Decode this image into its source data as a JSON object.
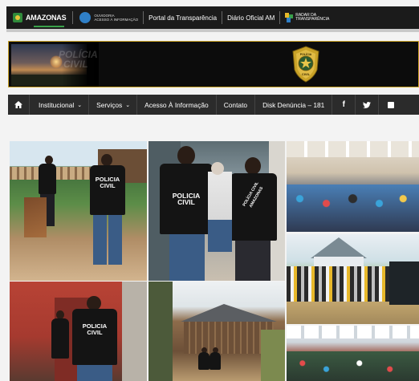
{
  "gov_bar": {
    "brand": "AMAZONAS",
    "ouvidoria_line1": "OUVIDORIA",
    "ouvidoria_line2": "ACESSO À INFORMAÇÃO",
    "link_transparencia": "Portal da Transparência",
    "link_diario": "Diário Oficial AM",
    "radar_line1": "RADAR DA",
    "radar_line2": "TRANSPARÊNCIA"
  },
  "banner": {
    "watermark_line1": "POLÍCIA",
    "watermark_line2": "CIVIL",
    "badge_top": "POLÍCIA",
    "badge_bottom": "CIVIL",
    "badge_color": "#c9a227"
  },
  "nav": {
    "home_icon": "home-icon",
    "items": [
      {
        "label": "Institucional",
        "dropdown": true
      },
      {
        "label": "Serviços",
        "dropdown": true
      },
      {
        "label": "Acesso À Informação",
        "dropdown": false
      },
      {
        "label": "Contato",
        "dropdown": false
      },
      {
        "label": "Disk Denúncia – 181",
        "dropdown": false
      }
    ],
    "social": [
      {
        "icon": "facebook-icon",
        "glyph": "f"
      },
      {
        "icon": "twitter-icon",
        "glyph": "🐦"
      },
      {
        "icon": "instagram-icon",
        "glyph": "▢"
      }
    ]
  },
  "gallery": {
    "vest_text_line1": "POLICIA",
    "vest_text_line2": "CIVIL",
    "vest_text_alt": "POLÍCIA CIVIL AMAZONAS"
  },
  "colors": {
    "nav_bg": "#2b2b2b",
    "gov_bar_bg": "#1b1b1b",
    "accent_gold": "#c9a227"
  }
}
